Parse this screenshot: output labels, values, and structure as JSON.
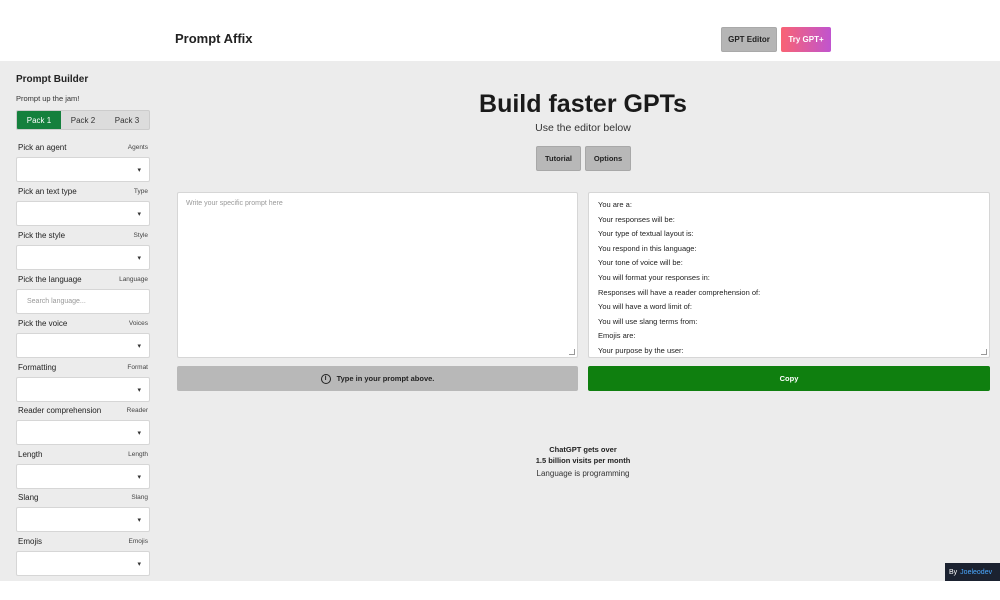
{
  "header": {
    "brand": "Prompt Affix",
    "editor_button": "GPT Editor",
    "try_button": "Try GPT+"
  },
  "sidebar": {
    "title": "Prompt Builder",
    "subtitle": "Prompt up the jam!",
    "packs": [
      "Pack 1",
      "Pack 2",
      "Pack 3"
    ],
    "active_pack": "Pack 1",
    "fields": [
      {
        "label": "Pick an agent",
        "tag": "Agents",
        "kind": "select",
        "value": ""
      },
      {
        "label": "Pick an text type",
        "tag": "Type",
        "kind": "select",
        "value": ""
      },
      {
        "label": "Pick the style",
        "tag": "Style",
        "kind": "select",
        "value": ""
      },
      {
        "label": "Pick the language",
        "tag": "Language",
        "kind": "search",
        "placeholder": "Search language..."
      },
      {
        "label": "Pick the voice",
        "tag": "Voices",
        "kind": "select",
        "value": ""
      },
      {
        "label": "Formatting",
        "tag": "Format",
        "kind": "select",
        "value": ""
      },
      {
        "label": "Reader comprehension",
        "tag": "Reader",
        "kind": "select",
        "value": ""
      },
      {
        "label": "Length",
        "tag": "Length",
        "kind": "select",
        "value": ""
      },
      {
        "label": "Slang",
        "tag": "Slang",
        "kind": "select",
        "value": ""
      },
      {
        "label": "Emojis",
        "tag": "Emojis",
        "kind": "select",
        "value": ""
      }
    ]
  },
  "hero": {
    "title": "Build faster GPTs",
    "subtitle": "Use the editor below",
    "tutorial_button": "Tutorial",
    "options_button": "Options"
  },
  "editor": {
    "prompt_placeholder": "Write your specific prompt here",
    "output_lines": [
      "You are a:",
      "Your responses will be:",
      "Your type of textual layout is:",
      "You respond in this language:",
      "Your tone of voice will be:",
      "You will format your responses in:",
      "Responses will have a reader comprehension of:",
      "You will have a word limit of:",
      "You will use slang terms from:",
      "Emojis are:",
      "Your purpose by the user:"
    ],
    "type_button": "Type in your prompt above.",
    "copy_button": "Copy"
  },
  "stats": {
    "line1": "ChatGPT gets over",
    "line2": "1.5 billion visits per month",
    "tagline": "Language is programming"
  },
  "footer": {
    "by": "By",
    "author": "Joeleodev"
  }
}
